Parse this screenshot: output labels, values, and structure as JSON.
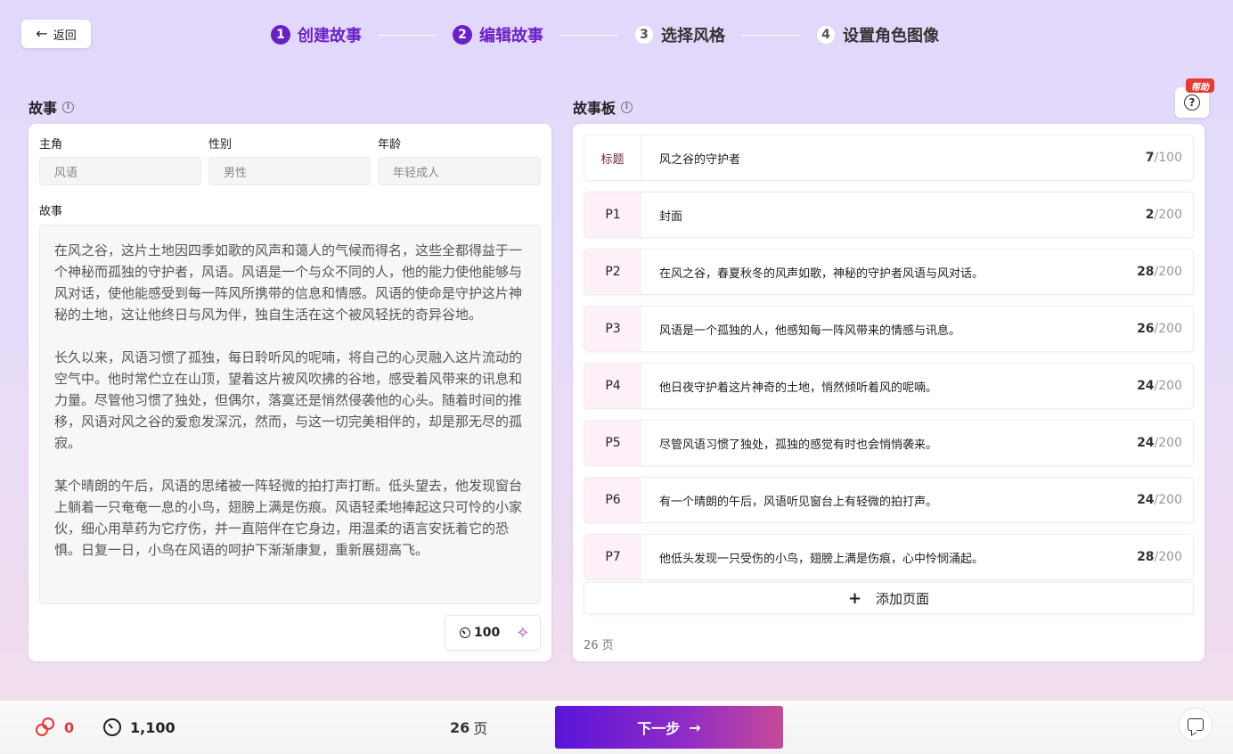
{
  "header": {
    "back_label": "返回",
    "steps": [
      {
        "num": "1",
        "label": "创建故事"
      },
      {
        "num": "2",
        "label": "编辑故事"
      },
      {
        "num": "3",
        "label": "选择风格"
      },
      {
        "num": "4",
        "label": "设置角色图像"
      }
    ]
  },
  "story_panel": {
    "title": "故事",
    "fields": {
      "protagonist_label": "主角",
      "protagonist_placeholder": "风语",
      "gender_label": "性别",
      "gender_placeholder": "男性",
      "age_label": "年龄",
      "age_placeholder": "年轻成人"
    },
    "story_label": "故事",
    "story_paragraphs": [
      "在风之谷，这片土地因四季如歌的风声和蔼人的气候而得名，这些全都得益于一个神秘而孤独的守护者，风语。风语是一个与众不同的人，他的能力使他能够与风对话，使他能感受到每一阵风所携带的信息和情感。风语的使命是守护这片神秘的土地，这让他终日与风为伴，独自生活在这个被风轻抚的奇异谷地。",
      "长久以来，风语习惯了孤独，每日聆听风的呢喃，将自己的心灵融入这片流动的空气中。他时常伫立在山顶，望着这片被风吹拂的谷地，感受着风带来的讯息和力量。尽管他习惯了独处，但偶尔，落寞还是悄然侵袭他的心头。随着时间的推移，风语对风之谷的爱愈发深沉，然而，与这一切完美相伴的，却是那无尽的孤寂。",
      "某个晴朗的午后，风语的思绪被一阵轻微的拍打声打断。低头望去，他发现窗台上躺着一只奄奄一息的小鸟，翅膀上满是伤痕。风语轻柔地捧起这只可怜的小家伙，细心用草药为它疗伤，并一直陪伴在它身边，用温柔的语言安抚着它的恐惧。日复一日，小鸟在风语的呵护下渐渐康复，重新展翅高飞。"
    ],
    "generate_cost": "100"
  },
  "storyboard": {
    "title": "故事板",
    "help_badge": "帮助",
    "title_row": {
      "tag": "标题",
      "text": "风之谷的守护者",
      "count": "7",
      "max": "/100"
    },
    "pages": [
      {
        "tag": "P1",
        "text": "封面",
        "count": "2",
        "max": "/200"
      },
      {
        "tag": "P2",
        "text": "在风之谷，春夏秋冬的风声如歌，神秘的守护者风语与风对话。",
        "count": "28",
        "max": "/200"
      },
      {
        "tag": "P3",
        "text": "风语是一个孤独的人，他感知每一阵风带来的情感与讯息。",
        "count": "26",
        "max": "/200"
      },
      {
        "tag": "P4",
        "text": "他日夜守护着这片神奇的土地，悄然倾听着风的呢喃。",
        "count": "24",
        "max": "/200"
      },
      {
        "tag": "P5",
        "text": "尽管风语习惯了独处，孤独的感觉有时也会悄悄袭来。",
        "count": "24",
        "max": "/200"
      },
      {
        "tag": "P6",
        "text": "有一个晴朗的午后，风语听见窗台上有轻微的拍打声。",
        "count": "24",
        "max": "/200"
      },
      {
        "tag": "P7",
        "text": "他低头发现一只受伤的小鸟，翅膀上满是伤痕，心中怜悯涌起。",
        "count": "28",
        "max": "/200"
      }
    ],
    "add_page_label": "添加页面",
    "page_total": "26 页"
  },
  "footer": {
    "coins": "0",
    "time_credits": "1,100",
    "pages_count": "26",
    "pages_unit": "页",
    "next_label": "下一步"
  },
  "colors": {
    "accent": "#6b21c8",
    "coin": "#e53935",
    "page_tag_bg": "#fdf0f8"
  }
}
